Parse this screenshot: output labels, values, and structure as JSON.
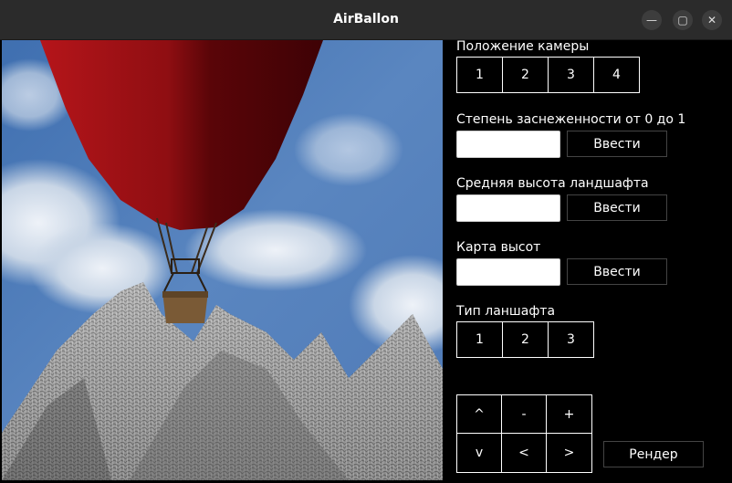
{
  "window": {
    "title": "AirBallon",
    "minimize_icon": "minimize-icon",
    "maximize_icon": "maximize-icon",
    "close_icon": "close-icon"
  },
  "viewport": {
    "scene": "3d-render-hot-air-balloon-over-mountains"
  },
  "panel": {
    "camera_label": "Положение камеры",
    "camera_buttons": [
      "1",
      "2",
      "3",
      "4"
    ],
    "snow_label": "Степень заснеженности от 0 до 1",
    "snow_input_value": "",
    "snow_submit": "Ввести",
    "height_label": "Средняя высота ландшафта",
    "height_input_value": "",
    "height_submit": "Ввести",
    "map_label": "Карта высот",
    "map_input_value": "",
    "map_submit": "Ввести",
    "terrain_label": "Тип ланшафта",
    "terrain_buttons": [
      "1",
      "2",
      "3"
    ],
    "controls": [
      "^",
      "-",
      "+",
      "v",
      "<",
      ">"
    ],
    "render_button": "Рендер"
  }
}
